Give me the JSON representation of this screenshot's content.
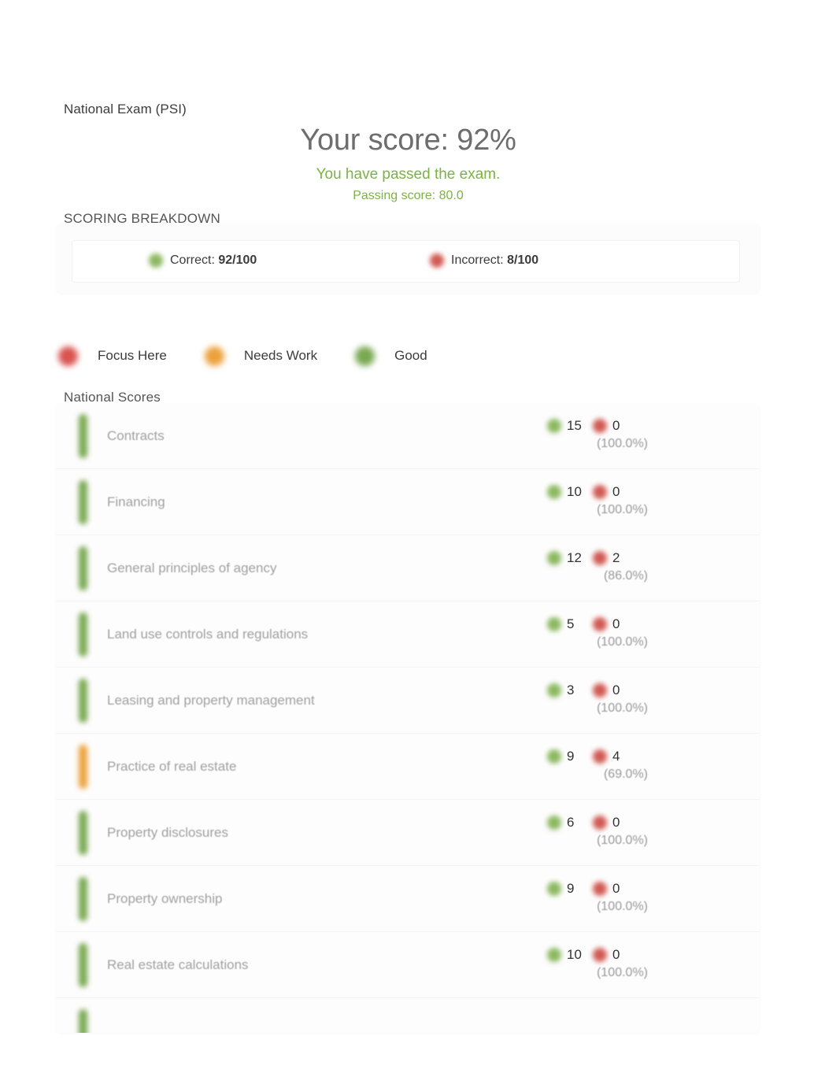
{
  "header": {
    "exam_title": "National Exam (PSI)",
    "score_headline": "Your score: 92%",
    "pass_message": "You have passed the exam.",
    "passing_score": "Passing score: 80.0"
  },
  "breakdown": {
    "section_label": "SCORING BREAKDOWN",
    "correct_label": "Correct:",
    "correct_value": "92/100",
    "incorrect_label": "Incorrect:",
    "incorrect_value": "8/100",
    "correct_icon": "check-circle-icon",
    "incorrect_icon": "x-circle-icon"
  },
  "legend": {
    "items": [
      {
        "label": "Focus Here",
        "color": "#d9534f",
        "key": "focus"
      },
      {
        "label": "Needs Work",
        "color": "#eca23c",
        "key": "needs"
      },
      {
        "label": "Good",
        "color": "#79a851",
        "key": "good"
      }
    ]
  },
  "scores": {
    "section_label": "National Scores",
    "rows": [
      {
        "topic": "Contracts",
        "correct": "15",
        "incorrect": "0",
        "percent": "(100.0%)",
        "status": "good"
      },
      {
        "topic": "Financing",
        "correct": "10",
        "incorrect": "0",
        "percent": "(100.0%)",
        "status": "good"
      },
      {
        "topic": "General principles of agency",
        "correct": "12",
        "incorrect": "2",
        "percent": "(86.0%)",
        "status": "good"
      },
      {
        "topic": "Land use controls and regulations",
        "correct": "5",
        "incorrect": "0",
        "percent": "(100.0%)",
        "status": "good"
      },
      {
        "topic": "Leasing and property management",
        "correct": "3",
        "incorrect": "0",
        "percent": "(100.0%)",
        "status": "good"
      },
      {
        "topic": "Practice of real estate",
        "correct": "9",
        "incorrect": "4",
        "percent": "(69.0%)",
        "status": "needs"
      },
      {
        "topic": "Property disclosures",
        "correct": "6",
        "incorrect": "0",
        "percent": "(100.0%)",
        "status": "good"
      },
      {
        "topic": "Property ownership",
        "correct": "9",
        "incorrect": "0",
        "percent": "(100.0%)",
        "status": "good"
      },
      {
        "topic": "Real estate calculations",
        "correct": "10",
        "incorrect": "0",
        "percent": "(100.0%)",
        "status": "good"
      },
      {
        "topic": "",
        "correct": "",
        "incorrect": "",
        "percent": "",
        "status": "good",
        "partial": true
      }
    ]
  }
}
